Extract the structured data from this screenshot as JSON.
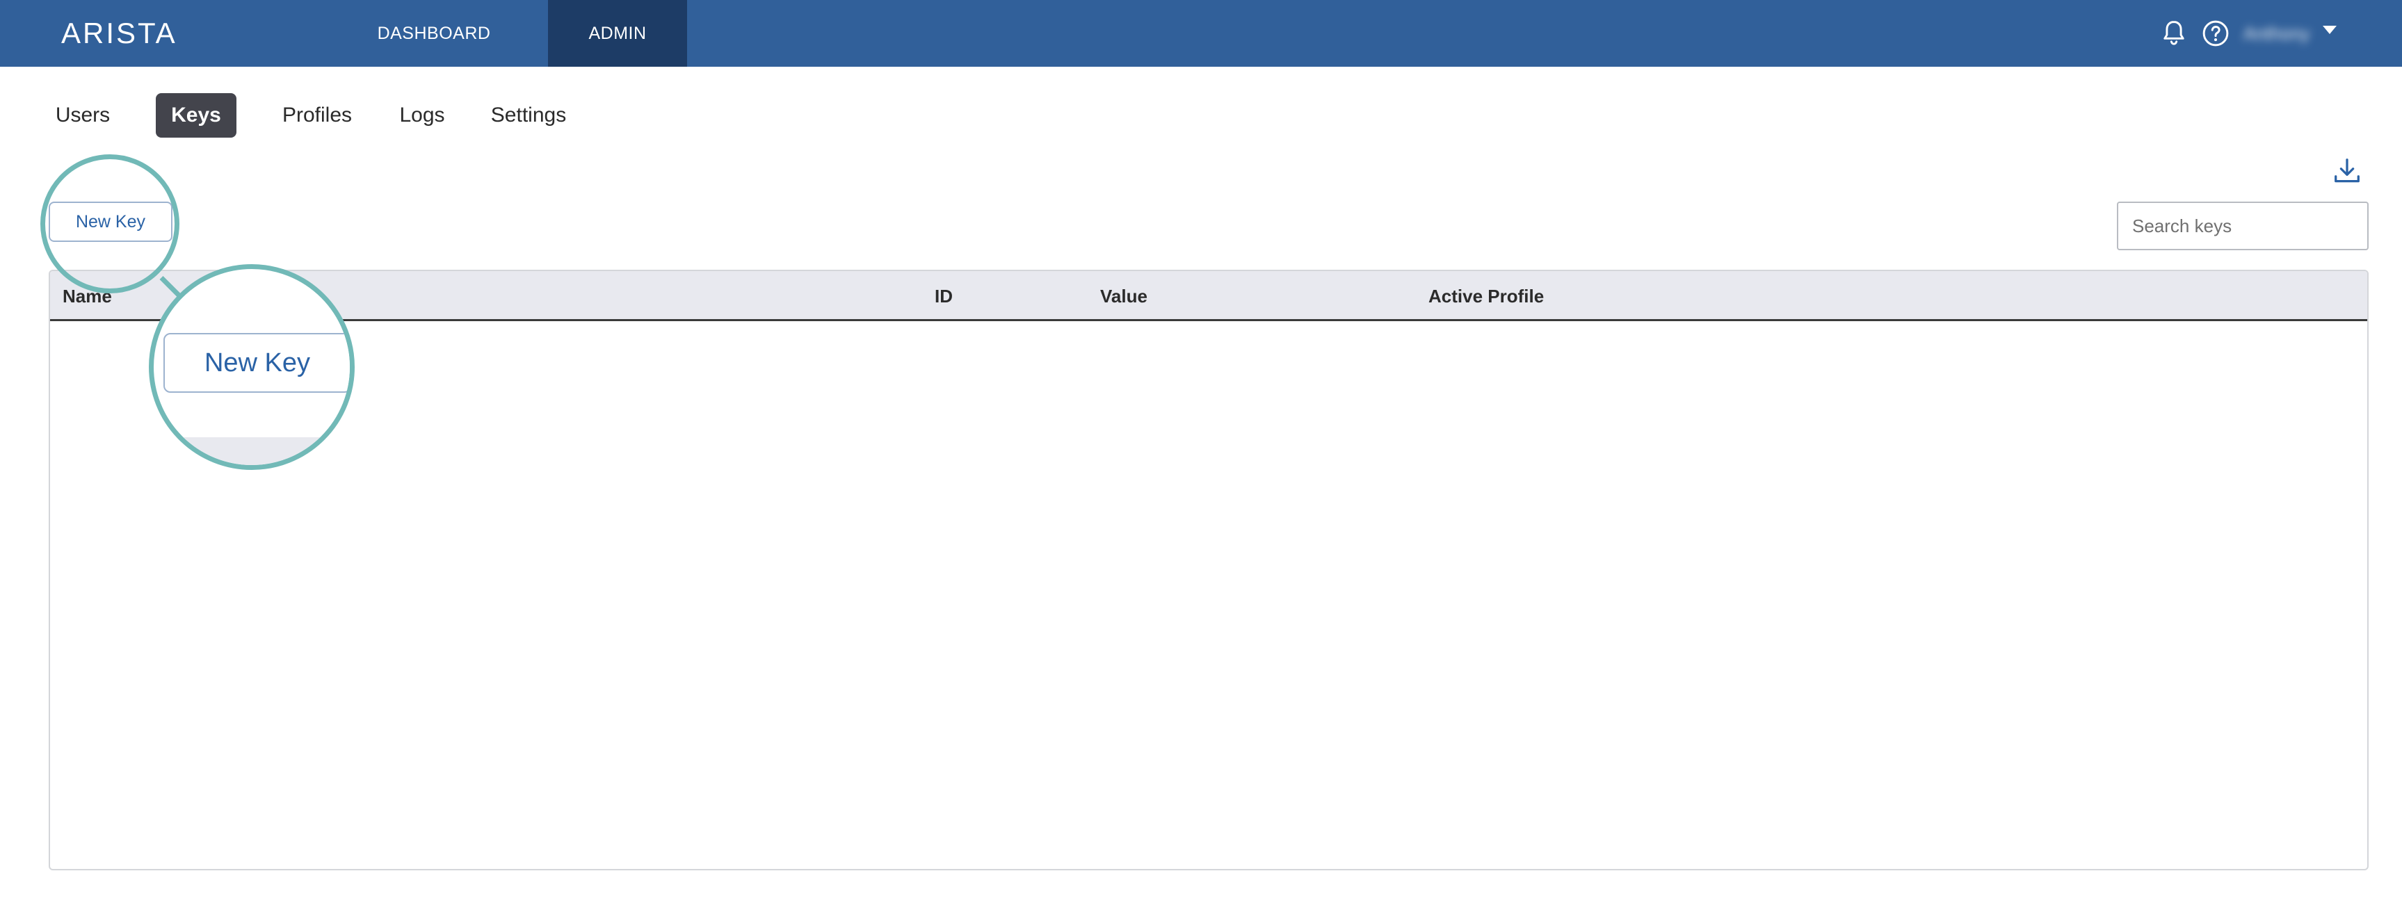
{
  "header": {
    "logo_text": "ARISTA",
    "nav": [
      {
        "label": "DASHBOARD",
        "active": false
      },
      {
        "label": "ADMIN",
        "active": true
      }
    ],
    "icons": [
      "bell-icon",
      "help-icon"
    ],
    "user_name": "Anthony",
    "colors": {
      "bar": "#31609a",
      "active_tab": "#1d3c66"
    }
  },
  "tabs": [
    {
      "label": "Users",
      "active": false
    },
    {
      "label": "Keys",
      "active": true
    },
    {
      "label": "Profiles",
      "active": false
    },
    {
      "label": "Logs",
      "active": false
    },
    {
      "label": "Settings",
      "active": false
    }
  ],
  "toolbar": {
    "new_key_label": "New Key",
    "search_placeholder": "Search keys",
    "download_icon": "download-icon"
  },
  "table": {
    "columns": [
      "Name",
      "ID",
      "Value",
      "Active Profile"
    ],
    "rows": []
  },
  "callout": {
    "label": "New Key",
    "color": "#71b9b7"
  }
}
